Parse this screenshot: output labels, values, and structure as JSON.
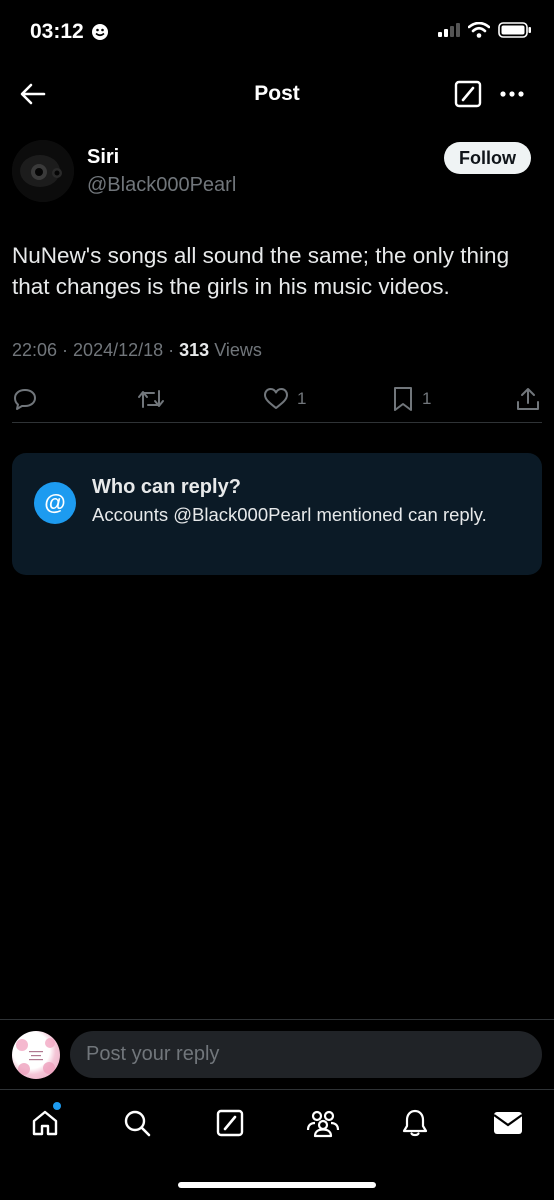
{
  "status_bar": {
    "time": "03:12"
  },
  "header": {
    "title": "Post"
  },
  "post": {
    "author_name": "Siri",
    "author_handle": "@Black000Pearl",
    "follow_label": "Follow",
    "text": "NuNew's songs all sound the same; the only thing that changes is the girls in his music videos.",
    "time": "22:06",
    "date": "2024/12/18",
    "views_count": "313",
    "views_label": "Views",
    "likes": "1",
    "bookmarks": "1"
  },
  "reply_restriction": {
    "icon": "@",
    "title": "Who can reply?",
    "text": "Accounts @Black000Pearl mentioned can reply."
  },
  "reply_bar": {
    "placeholder": "Post your reply"
  },
  "nav": {
    "items": [
      "home-icon",
      "search-icon",
      "compose-icon",
      "communities-icon",
      "notifications-icon",
      "messages-icon"
    ]
  },
  "colors": {
    "accent": "#1d9bf0",
    "background": "#000000",
    "card": "#0b1a26",
    "muted": "#71767b"
  }
}
